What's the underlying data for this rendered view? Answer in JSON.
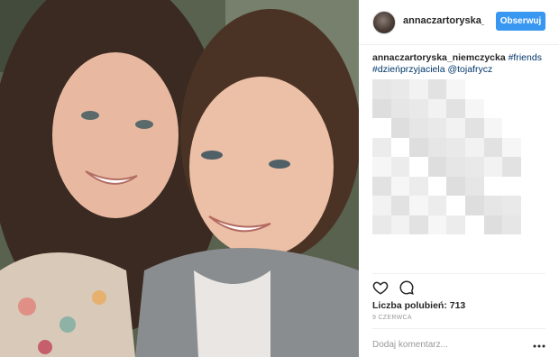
{
  "post": {
    "username": "annaczartoryska_niemczycka",
    "follow_label": "Obserwuj",
    "caption": {
      "author": "annaczartoryska_niemczycka",
      "hashtag_friends": "#friends",
      "hashtag_day": "#dzieńprzyjaciela",
      "mention": "@tojafrycz"
    },
    "likes_text": "Liczba polubień: 713",
    "date": "9 CZERWCA",
    "comment_placeholder": "Dodaj komentarz..."
  },
  "icons": {
    "like": "heart-icon",
    "comment": "comment-icon",
    "more": "more-options-icon"
  },
  "colors": {
    "follow_button": "#3897f0",
    "link": "#003569",
    "muted": "#999999"
  }
}
